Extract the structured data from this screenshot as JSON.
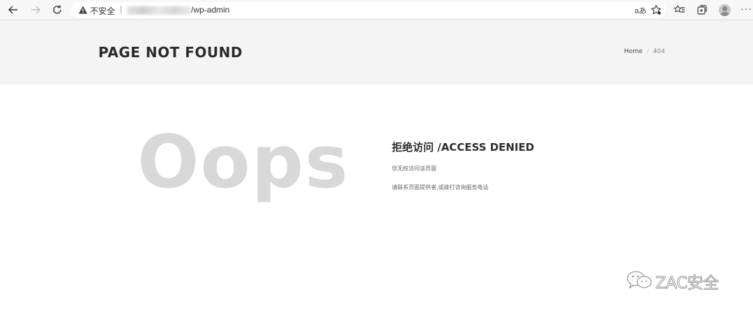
{
  "browser": {
    "security_label": "不安全",
    "separator": "|",
    "url_visible": "/wp-admin",
    "read_aloud_label": "aあ"
  },
  "page": {
    "title": "PAGE NOT FOUND",
    "breadcrumb": {
      "home": "Home",
      "divider": "/",
      "current": "404"
    }
  },
  "content": {
    "oops": "Oops",
    "heading": "拒绝访问 /ACCESS DENIED",
    "message_1": "您无权访问该页面",
    "message_2": "请联系页面提供者,或拨打咨询服务电话"
  },
  "watermark": {
    "text": "ZAC安全"
  },
  "colors": {
    "header_band": "#f4f4f4",
    "oops_text": "#d8d8d8",
    "title_text": "#2b2b2b"
  },
  "icons": [
    "back-arrow-icon",
    "forward-arrow-icon",
    "refresh-icon",
    "warning-icon",
    "favorite-star-icon",
    "reading-list-icon",
    "collections-icon",
    "profile-avatar-icon",
    "more-menu-icon",
    "wechat-icon"
  ]
}
